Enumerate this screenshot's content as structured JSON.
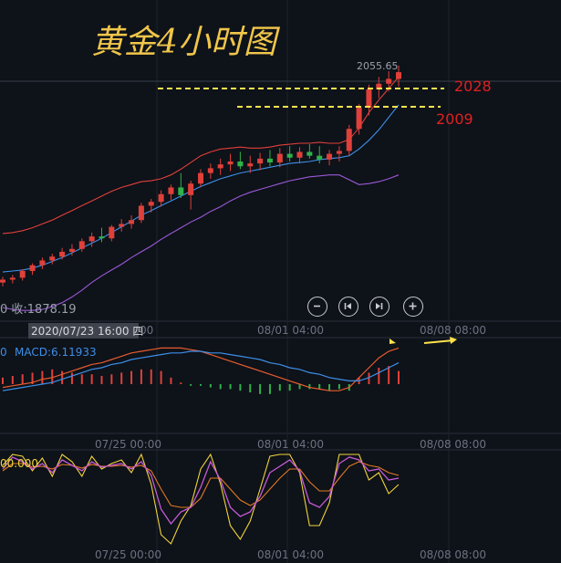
{
  "title_text": "黄金4小时图",
  "price_label": "2055.65",
  "level_high": "2028",
  "level_low": "2009",
  "close_text": "0 收:1878.19",
  "crosshair_time": "2020/07/23 16:00 四",
  "x_tick_labels": [
    "07/25 00:00",
    "08/01 04:00",
    "08/08 08:00"
  ],
  "macd_zero": "0",
  "macd_text": "MACD:6.11933",
  "kdj_text": "00.000",
  "controls": [
    "zoom-out",
    "previous",
    "next",
    "zoom-in"
  ],
  "colors": {
    "background": "#0e1219",
    "bull": "#e0403a",
    "bear": "#2fb24a",
    "upper_band": "#e0403a",
    "middle_band": "#3d8fe8",
    "lower_band": "#9b59d8",
    "level_line": "#ffe34d",
    "level_label": "#e02020",
    "title": "#f0c64a",
    "macd_dif": "#e65c2e",
    "macd_dea": "#3d8fe8",
    "k_line": "#f0d43a",
    "d_line": "#e07a22",
    "j_line": "#c85ad8"
  },
  "chart_data": {
    "type": "candlestick",
    "instrument": "黄金",
    "timeframe": "4小时",
    "x_ticks": [
      "07/25 00:00",
      "08/01 04:00",
      "08/08 08:00"
    ],
    "levels": [
      2028,
      2009
    ],
    "last_price": 2055.65,
    "close": 1878.19,
    "price_panel": {
      "bollinger_upper": [
        1877,
        1878,
        1880,
        1883,
        1887,
        1891,
        1896,
        1901,
        1906,
        1911,
        1916,
        1921,
        1925,
        1928,
        1931,
        1932,
        1934,
        1938,
        1944,
        1951,
        1958,
        1962,
        1965,
        1966,
        1967,
        1966,
        1966,
        1967,
        1969,
        1970,
        1971,
        1971,
        1972,
        1971,
        1971,
        1975,
        1987,
        2003,
        2016,
        2028,
        2040
      ],
      "bollinger_middle": [
        1837,
        1838,
        1839,
        1841,
        1844,
        1848,
        1852,
        1857,
        1862,
        1867,
        1872,
        1878,
        1884,
        1890,
        1896,
        1901,
        1906,
        1911,
        1916,
        1921,
        1926,
        1930,
        1934,
        1937,
        1940,
        1942,
        1944,
        1946,
        1948,
        1950,
        1951,
        1952,
        1954,
        1955,
        1956,
        1958,
        1965,
        1974,
        1985,
        1998,
        2011
      ],
      "bollinger_lower": [
        1800,
        1798,
        1797,
        1797,
        1798,
        1801,
        1805,
        1811,
        1818,
        1826,
        1833,
        1839,
        1845,
        1852,
        1858,
        1864,
        1871,
        1877,
        1883,
        1889,
        1894,
        1900,
        1905,
        1911,
        1916,
        1920,
        1923,
        1926,
        1929,
        1932,
        1934,
        1936,
        1937,
        1938,
        1938,
        1933,
        1928,
        1929,
        1931,
        1934,
        1938
      ],
      "candles": [
        {
          "o": 1826,
          "h": 1832,
          "l": 1822,
          "c": 1829
        },
        {
          "o": 1829,
          "h": 1834,
          "l": 1825,
          "c": 1831
        },
        {
          "o": 1831,
          "h": 1840,
          "l": 1828,
          "c": 1838
        },
        {
          "o": 1838,
          "h": 1846,
          "l": 1834,
          "c": 1844
        },
        {
          "o": 1844,
          "h": 1852,
          "l": 1840,
          "c": 1849
        },
        {
          "o": 1849,
          "h": 1856,
          "l": 1845,
          "c": 1853
        },
        {
          "o": 1853,
          "h": 1862,
          "l": 1850,
          "c": 1858
        },
        {
          "o": 1858,
          "h": 1866,
          "l": 1854,
          "c": 1861
        },
        {
          "o": 1861,
          "h": 1872,
          "l": 1858,
          "c": 1869
        },
        {
          "o": 1869,
          "h": 1878,
          "l": 1863,
          "c": 1874
        },
        {
          "o": 1874,
          "h": 1883,
          "l": 1868,
          "c": 1872
        },
        {
          "o": 1872,
          "h": 1886,
          "l": 1869,
          "c": 1884
        },
        {
          "o": 1884,
          "h": 1892,
          "l": 1879,
          "c": 1887
        },
        {
          "o": 1887,
          "h": 1896,
          "l": 1882,
          "c": 1891
        },
        {
          "o": 1891,
          "h": 1909,
          "l": 1888,
          "c": 1906
        },
        {
          "o": 1906,
          "h": 1913,
          "l": 1899,
          "c": 1910
        },
        {
          "o": 1910,
          "h": 1922,
          "l": 1905,
          "c": 1918
        },
        {
          "o": 1918,
          "h": 1928,
          "l": 1912,
          "c": 1925
        },
        {
          "o": 1925,
          "h": 1940,
          "l": 1914,
          "c": 1917
        },
        {
          "o": 1917,
          "h": 1932,
          "l": 1902,
          "c": 1929
        },
        {
          "o": 1929,
          "h": 1944,
          "l": 1925,
          "c": 1940
        },
        {
          "o": 1940,
          "h": 1950,
          "l": 1934,
          "c": 1945
        },
        {
          "o": 1945,
          "h": 1955,
          "l": 1938,
          "c": 1949
        },
        {
          "o": 1949,
          "h": 1960,
          "l": 1942,
          "c": 1952
        },
        {
          "o": 1952,
          "h": 1962,
          "l": 1944,
          "c": 1947
        },
        {
          "o": 1947,
          "h": 1958,
          "l": 1940,
          "c": 1950
        },
        {
          "o": 1950,
          "h": 1961,
          "l": 1943,
          "c": 1955
        },
        {
          "o": 1955,
          "h": 1964,
          "l": 1947,
          "c": 1951
        },
        {
          "o": 1951,
          "h": 1966,
          "l": 1946,
          "c": 1960
        },
        {
          "o": 1960,
          "h": 1968,
          "l": 1952,
          "c": 1956
        },
        {
          "o": 1956,
          "h": 1967,
          "l": 1950,
          "c": 1962
        },
        {
          "o": 1962,
          "h": 1970,
          "l": 1955,
          "c": 1958
        },
        {
          "o": 1958,
          "h": 1968,
          "l": 1950,
          "c": 1954
        },
        {
          "o": 1954,
          "h": 1964,
          "l": 1948,
          "c": 1960
        },
        {
          "o": 1960,
          "h": 1968,
          "l": 1952,
          "c": 1963
        },
        {
          "o": 1963,
          "h": 1990,
          "l": 1958,
          "c": 1986
        },
        {
          "o": 1986,
          "h": 2012,
          "l": 1980,
          "c": 2008
        },
        {
          "o": 2008,
          "h": 2032,
          "l": 2000,
          "c": 2027
        },
        {
          "o": 2027,
          "h": 2040,
          "l": 2018,
          "c": 2033
        },
        {
          "o": 2033,
          "h": 2046,
          "l": 2025,
          "c": 2038
        },
        {
          "o": 2038,
          "h": 2052,
          "l": 2030,
          "c": 2045
        }
      ]
    },
    "macd_panel": {
      "dif": [
        -2,
        -1,
        0,
        1,
        3,
        4,
        6,
        8,
        10,
        12,
        13,
        15,
        17,
        19,
        20,
        21,
        22,
        22,
        22,
        21,
        20,
        18,
        16,
        14,
        12,
        10,
        8,
        6,
        4,
        2,
        0,
        -2,
        -3,
        -4,
        -4,
        -2,
        4,
        10,
        16,
        20,
        22
      ],
      "dea": [
        -4,
        -3,
        -2,
        -1,
        0,
        1,
        3,
        5,
        7,
        9,
        10,
        12,
        13,
        15,
        16,
        17,
        18,
        19,
        19,
        20,
        20,
        19,
        19,
        18,
        17,
        16,
        15,
        13,
        12,
        10,
        9,
        7,
        6,
        4,
        3,
        2,
        2,
        4,
        7,
        10,
        13
      ],
      "histogram": [
        4,
        5,
        6,
        7,
        8,
        9,
        8,
        7,
        6,
        6,
        5,
        6,
        7,
        8,
        9,
        9,
        8,
        4,
        1,
        -1,
        -1,
        -2,
        -3,
        -3,
        -4,
        -5,
        -6,
        -6,
        -4,
        -4,
        -3,
        -3,
        -3,
        -4,
        -3,
        -4,
        4,
        7,
        10,
        11,
        8
      ]
    },
    "kdj_panel": {
      "k": [
        82,
        95,
        90,
        82,
        88,
        78,
        92,
        86,
        80,
        90,
        84,
        86,
        88,
        82,
        90,
        75,
        38,
        22,
        35,
        40,
        62,
        90,
        70,
        40,
        30,
        35,
        52,
        78,
        85,
        92,
        80,
        45,
        40,
        52,
        88,
        95,
        92,
        80,
        82,
        70,
        72
      ],
      "d": [
        80,
        88,
        88,
        84,
        85,
        82,
        87,
        86,
        83,
        87,
        85,
        85,
        86,
        84,
        86,
        80,
        60,
        42,
        40,
        40,
        50,
        72,
        72,
        60,
        48,
        42,
        48,
        60,
        72,
        82,
        82,
        68,
        58,
        58,
        72,
        85,
        90,
        86,
        84,
        78,
        75
      ],
      "j": [
        86,
        98,
        96,
        80,
        94,
        74,
        98,
        90,
        74,
        96,
        82,
        88,
        92,
        78,
        98,
        65,
        10,
        0,
        25,
        42,
        82,
        98,
        66,
        20,
        5,
        25,
        60,
        96,
        98,
        98,
        78,
        20,
        20,
        45,
        98,
        98,
        98,
        70,
        78,
        55,
        65
      ]
    }
  }
}
